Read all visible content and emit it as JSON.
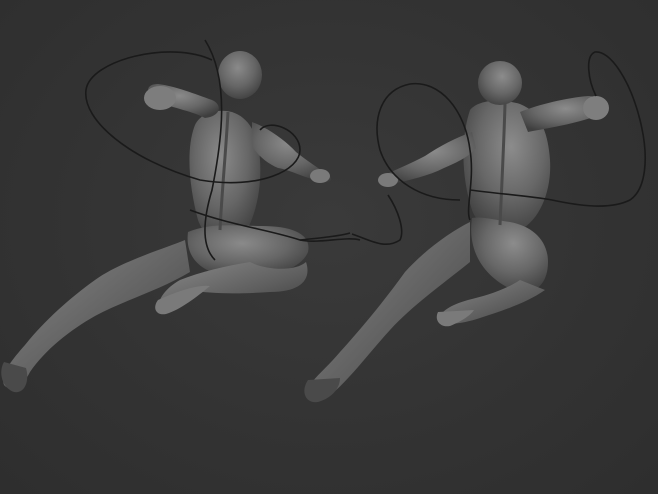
{
  "scene": {
    "background_color": "#333333",
    "figure_color": "#6e6e6e",
    "shadow_color": "#3c3c3c",
    "highlight_color": "#9a9a9a",
    "rope_color": "#1a1a1a"
  }
}
